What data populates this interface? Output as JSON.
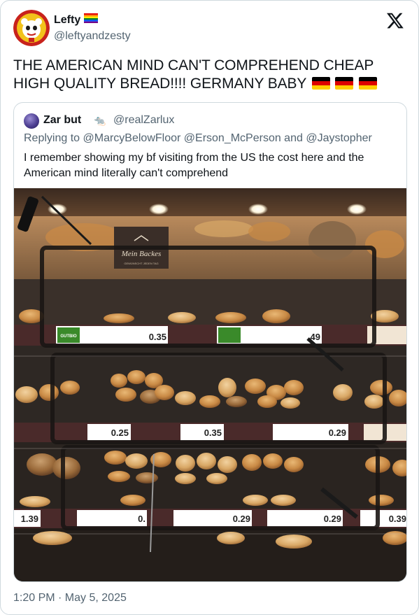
{
  "author": {
    "display_name": "Lefty",
    "name_emoji": "rainbow-flag-icon",
    "handle": "@leftyandzesty"
  },
  "tweet": {
    "text_line1": "THE AMERICAN MIND CAN'T COMPREHEND CHEAP",
    "text_line2": "HIGH QUALITY BREAD!!!! GERMANY BABY",
    "flags": [
      "german-flag-icon",
      "german-flag-icon",
      "german-flag-icon"
    ],
    "timestamp": "1:20 PM · May 5, 2025"
  },
  "quoted": {
    "display_name": "Zar but",
    "name_emoji": "🐀",
    "handle": "@realZarlux",
    "reply_prefix": "Replying to",
    "reply_to": "@MarcyBelowFloor @Erson_McPerson and @Jaystopher",
    "text_line1": "I remember showing my bf visiting from the US the cost here and the",
    "text_line2": "American mind literally can't comprehend"
  },
  "photo": {
    "sign_text": "Mein Backes",
    "sign_sub": "GEWÜNSCHT JEDEN TAG",
    "brand": "GUTBIO",
    "price_tags": [
      "0.35",
      "49",
      "0.25",
      "0.35",
      "0.29",
      "1.39",
      "0.",
      "0.29",
      "0.29",
      "0.39"
    ]
  },
  "colors": {
    "text": "#0f1419",
    "muted": "#536471",
    "border": "#cfd9de",
    "german_black": "#000000",
    "german_red": "#dd0000",
    "german_gold": "#ffce00"
  }
}
